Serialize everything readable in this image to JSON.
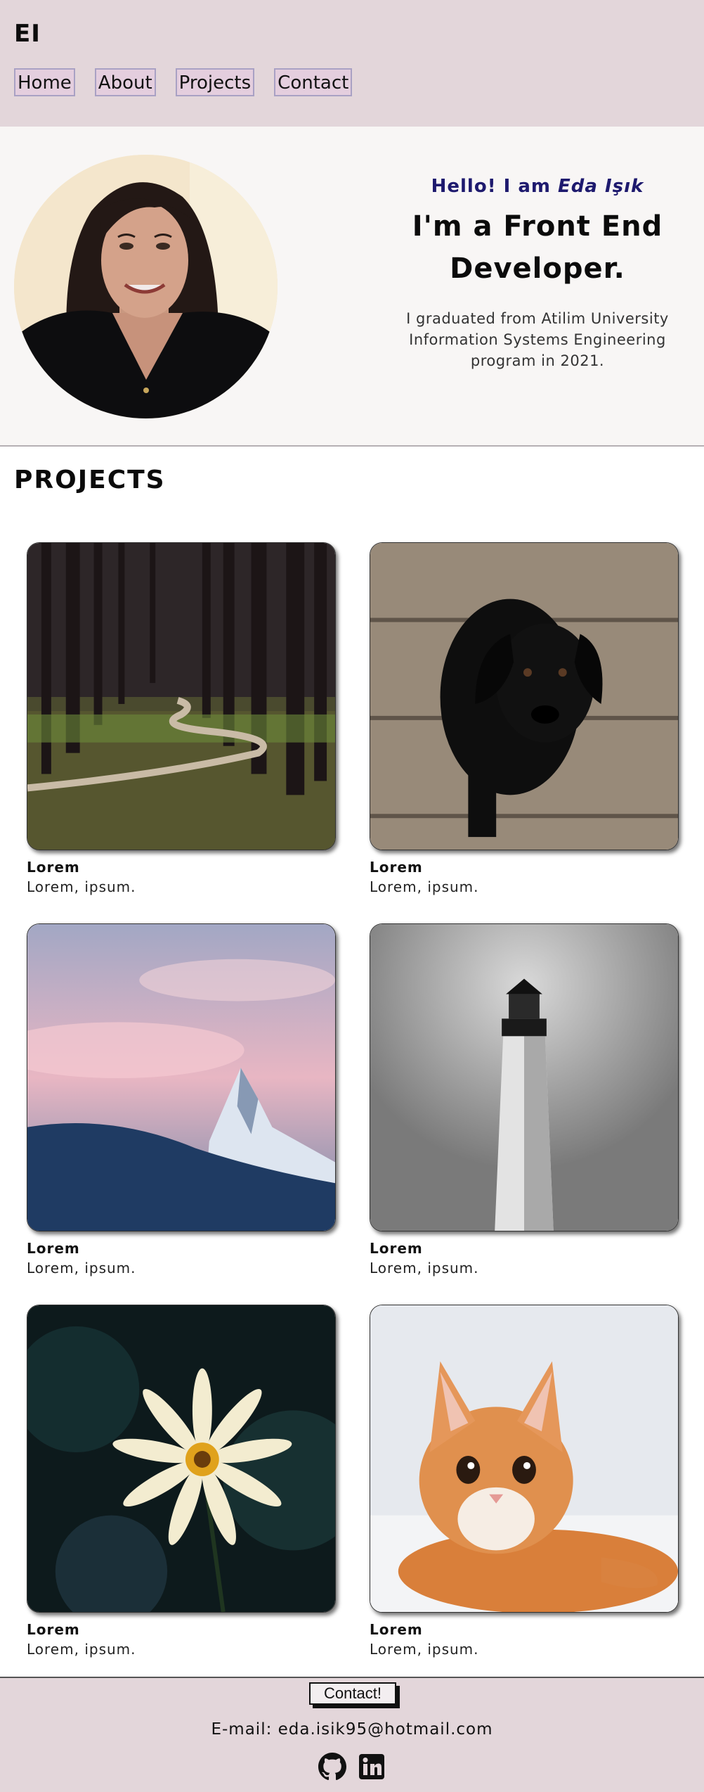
{
  "header": {
    "logo": "EI",
    "nav": [
      {
        "label": "Home"
      },
      {
        "label": "About"
      },
      {
        "label": "Projects"
      },
      {
        "label": "Contact"
      }
    ]
  },
  "hero": {
    "greeting": "Hello! I am ",
    "name": "Eda Işık",
    "role": "I'm a Front End Developer.",
    "bio": "I graduated from Atilim University Information Systems Engineering program in 2021."
  },
  "projects": {
    "title": "PROJECTS",
    "items": [
      {
        "title": "Lorem",
        "desc": "Lorem, ipsum.",
        "image": "forest-path"
      },
      {
        "title": "Lorem",
        "desc": "Lorem, ipsum.",
        "image": "black-puppy"
      },
      {
        "title": "Lorem",
        "desc": "Lorem, ipsum.",
        "image": "snowy-mountain"
      },
      {
        "title": "Lorem",
        "desc": "Lorem, ipsum.",
        "image": "lighthouse"
      },
      {
        "title": "Lorem",
        "desc": "Lorem, ipsum.",
        "image": "white-flower"
      },
      {
        "title": "Lorem",
        "desc": "Lorem, ipsum.",
        "image": "orange-cat"
      }
    ]
  },
  "footer": {
    "contact_label": "Contact!",
    "email": "E-mail: eda.isik95@hotmail.com",
    "socials": [
      {
        "icon": "github-icon"
      },
      {
        "icon": "linkedin-icon"
      }
    ]
  },
  "colors": {
    "header_bg": "#e3d6da",
    "hero_bg": "#f8f6f5",
    "accent": "#1e1a6e",
    "nav_button_bg": "#e4cede"
  }
}
